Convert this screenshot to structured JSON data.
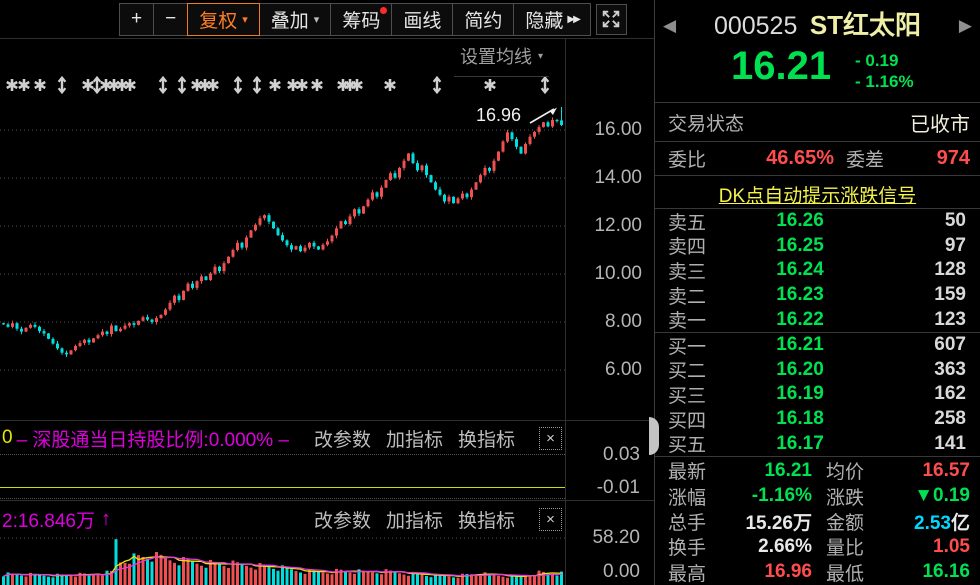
{
  "toolbar": {
    "buttons": [
      {
        "label": "+",
        "type": "plain"
      },
      {
        "label": "−",
        "type": "plain"
      },
      {
        "label": "复权",
        "type": "active-dropdown"
      },
      {
        "label": "叠加",
        "type": "dropdown"
      },
      {
        "label": "筹码",
        "type": "badge"
      },
      {
        "label": "画线",
        "type": "plain"
      },
      {
        "label": "简约",
        "type": "plain"
      },
      {
        "label": "隐藏",
        "type": "more"
      }
    ]
  },
  "chart": {
    "ma_setting_label": "设置均线",
    "annotation": "16.96",
    "y_tick_labels": [
      "16.00",
      "14.00",
      "12.00",
      "10.00",
      "8.00",
      "6.00"
    ]
  },
  "panel2": {
    "legend_prefix": "0",
    "legend": "– 深股通当日持股比例:0.000% –",
    "links": [
      "改参数",
      "加指标",
      "换指标"
    ],
    "close_label": "×",
    "y_tick_labels": [
      "0.03",
      "-0.01"
    ]
  },
  "panel3": {
    "legend": "2:16.846万",
    "arrow": "↑",
    "links": [
      "改参数",
      "加指标",
      "换指标"
    ],
    "close_label": "×",
    "y_tick_labels": [
      "58.20",
      "0.00"
    ]
  },
  "quote": {
    "code": "000525",
    "name": "ST红太阳",
    "price": "16.21",
    "change": "- 0.19",
    "change_pct": "- 1.16%",
    "status_label": "交易状态",
    "status_value": "已收市",
    "weibi_label": "委比",
    "weibi_value": "46.65%",
    "weicha_label": "委差",
    "weicha_value": "974",
    "dk_link": "DK点自动提示涨跌信号",
    "asks": [
      {
        "label": "卖五",
        "price": "16.26",
        "qty": "50"
      },
      {
        "label": "卖四",
        "price": "16.25",
        "qty": "97"
      },
      {
        "label": "卖三",
        "price": "16.24",
        "qty": "128"
      },
      {
        "label": "卖二",
        "price": "16.23",
        "qty": "159"
      },
      {
        "label": "卖一",
        "price": "16.22",
        "qty": "123"
      }
    ],
    "bids": [
      {
        "label": "买一",
        "price": "16.21",
        "qty": "607"
      },
      {
        "label": "买二",
        "price": "16.20",
        "qty": "363"
      },
      {
        "label": "买三",
        "price": "16.19",
        "qty": "162"
      },
      {
        "label": "买四",
        "price": "16.18",
        "qty": "258"
      },
      {
        "label": "买五",
        "price": "16.17",
        "qty": "141"
      }
    ],
    "stats": [
      [
        {
          "label": "最新",
          "value": "16.21",
          "color": "green"
        },
        {
          "label": "均价",
          "value": "16.57",
          "color": "red"
        }
      ],
      [
        {
          "label": "涨幅",
          "value": "-1.16%",
          "color": "green"
        },
        {
          "label": "涨跌",
          "value": "▼0.19",
          "color": "green"
        }
      ],
      [
        {
          "label": "总手",
          "value": "15.26万",
          "color": "white"
        },
        {
          "label": "金额",
          "value": "2.53",
          "suffix": "亿",
          "color": "cyan"
        }
      ],
      [
        {
          "label": "换手",
          "value": "2.66%",
          "color": "white"
        },
        {
          "label": "量比",
          "value": "1.05",
          "color": "red"
        }
      ],
      [
        {
          "label": "最高",
          "value": "16.96",
          "color": "red"
        },
        {
          "label": "最低",
          "value": "16.16",
          "color": "green"
        }
      ]
    ]
  },
  "colors": {
    "up_red": "#f05050",
    "down_cyan": "#00dede",
    "green": "#00e152",
    "red": "#ff4d4d",
    "white_val": "#e8e8e8",
    "cyan_val": "#00d9ff",
    "magenta": "#dd00dd",
    "yellow_line": "#d6d600",
    "grid": "#4f4f4f",
    "marker": "#d0d0d0"
  },
  "chart_data": [
    {
      "type": "candlestick",
      "name": "daily-k-adjusted",
      "ylim": [
        4.0,
        17.5
      ],
      "y_ticks": [
        16,
        14,
        12,
        10,
        8,
        6
      ],
      "open_first": 7.95,
      "closes": [
        7.9,
        7.8,
        7.95,
        7.72,
        7.6,
        7.76,
        7.88,
        7.8,
        7.62,
        7.52,
        7.3,
        7.1,
        6.9,
        6.72,
        6.65,
        6.82,
        7.0,
        7.12,
        7.26,
        7.15,
        7.32,
        7.45,
        7.6,
        7.5,
        7.85,
        7.62,
        7.72,
        7.85,
        7.95,
        7.88,
        8.05,
        8.2,
        8.1,
        8.0,
        8.16,
        8.3,
        8.52,
        8.8,
        9.1,
        8.92,
        9.3,
        9.6,
        9.42,
        9.7,
        9.9,
        9.75,
        10.02,
        10.3,
        10.12,
        10.45,
        10.72,
        11.0,
        11.3,
        11.1,
        11.52,
        11.82,
        12.05,
        12.32,
        12.45,
        12.18,
        11.9,
        11.62,
        11.4,
        11.2,
        11.02,
        11.16,
        10.95,
        11.1,
        11.3,
        11.15,
        11.02,
        11.22,
        11.36,
        11.6,
        11.9,
        12.2,
        12.08,
        12.4,
        12.7,
        12.52,
        12.82,
        13.1,
        13.4,
        13.22,
        13.6,
        13.92,
        14.2,
        14.02,
        14.42,
        14.72,
        15.02,
        14.62,
        14.32,
        14.52,
        14.12,
        13.82,
        13.52,
        13.3,
        13.02,
        13.22,
        12.95,
        13.15,
        13.35,
        13.2,
        13.52,
        13.82,
        14.12,
        14.42,
        14.3,
        14.72,
        15.1,
        15.52,
        15.9,
        15.62,
        15.3,
        15.02,
        15.42,
        15.72,
        15.92,
        16.12,
        16.32,
        16.15,
        16.42,
        16.4,
        16.21
      ],
      "last_candle": {
        "open": 16.4,
        "high": 16.96,
        "low": 16.16,
        "close": 16.21
      },
      "high_annotation": 16.96,
      "markers": [
        {
          "x": 12,
          "t": "star"
        },
        {
          "x": 24,
          "t": "star"
        },
        {
          "x": 40,
          "t": "star"
        },
        {
          "x": 62,
          "t": "arrows"
        },
        {
          "x": 88,
          "t": "star"
        },
        {
          "x": 97,
          "t": "arrows"
        },
        {
          "x": 106,
          "t": "star"
        },
        {
          "x": 114,
          "t": "star"
        },
        {
          "x": 122,
          "t": "star"
        },
        {
          "x": 130,
          "t": "star"
        },
        {
          "x": 163,
          "t": "arrows"
        },
        {
          "x": 182,
          "t": "arrows"
        },
        {
          "x": 197,
          "t": "star"
        },
        {
          "x": 205,
          "t": "star"
        },
        {
          "x": 213,
          "t": "star"
        },
        {
          "x": 238,
          "t": "arrows"
        },
        {
          "x": 257,
          "t": "arrows"
        },
        {
          "x": 275,
          "t": "star"
        },
        {
          "x": 293,
          "t": "star"
        },
        {
          "x": 302,
          "t": "star"
        },
        {
          "x": 317,
          "t": "star"
        },
        {
          "x": 343,
          "t": "star"
        },
        {
          "x": 350,
          "t": "star"
        },
        {
          "x": 357,
          "t": "star"
        },
        {
          "x": 390,
          "t": "star"
        },
        {
          "x": 437,
          "t": "arrows"
        },
        {
          "x": 490,
          "t": "star"
        },
        {
          "x": 545,
          "t": "arrows"
        }
      ]
    },
    {
      "type": "line",
      "name": "深股通当日持股比例",
      "current": 0.0,
      "y_ticks": [
        0.03,
        -0.01
      ],
      "flat_value": 0.0
    },
    {
      "type": "bar",
      "name": "成交量",
      "y_ticks": [
        58.2,
        0.0
      ],
      "spike_day": 25,
      "spike_value": 58,
      "volume_points": [
        [
          0,
          14
        ],
        [
          10,
          12
        ],
        [
          20,
          13
        ],
        [
          24,
          16
        ],
        [
          25,
          58
        ],
        [
          26,
          30
        ],
        [
          28,
          34
        ],
        [
          32,
          36
        ],
        [
          36,
          33
        ],
        [
          40,
          30
        ],
        [
          45,
          28
        ],
        [
          50,
          26
        ],
        [
          55,
          25
        ],
        [
          60,
          22
        ],
        [
          65,
          18
        ],
        [
          70,
          16
        ],
        [
          75,
          18
        ],
        [
          80,
          16
        ],
        [
          85,
          17
        ],
        [
          90,
          15
        ],
        [
          95,
          12
        ],
        [
          100,
          11
        ],
        [
          105,
          14
        ],
        [
          110,
          12
        ],
        [
          115,
          10
        ],
        [
          118,
          16
        ],
        [
          124,
          14
        ]
      ]
    }
  ]
}
